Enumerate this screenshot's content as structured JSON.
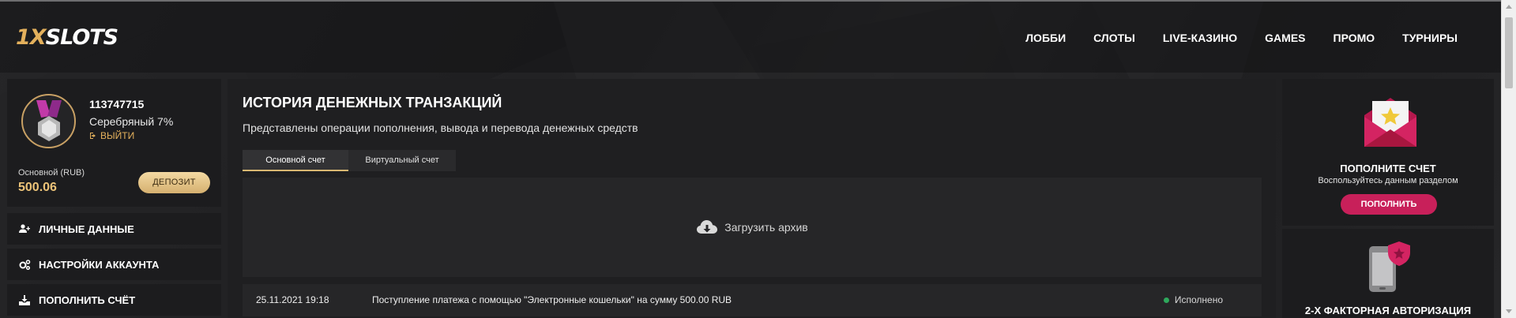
{
  "header": {
    "logo": {
      "one": "1",
      "x": "X",
      "slots": "SLOTS"
    },
    "nav": [
      "ЛОББИ",
      "СЛОТЫ",
      "LIVE-КАЗИНО",
      "GAMES",
      "ПРОМО",
      "ТУРНИРЫ"
    ]
  },
  "profile": {
    "user_id": "113747715",
    "level": "Серебряный 7%",
    "logout": "ВЫЙТИ",
    "balance_label": "Основной (RUB)",
    "balance_value": "500.06",
    "deposit_button": "ДЕПОЗИТ"
  },
  "sidebar": {
    "items": [
      {
        "label": "ЛИЧНЫЕ ДАННЫЕ",
        "icon": "user-plus-icon"
      },
      {
        "label": "НАСТРОЙКИ АККАУНТА",
        "icon": "gears-icon"
      },
      {
        "label": "ПОПОЛНИТЬ СЧЁТ",
        "icon": "download-icon"
      }
    ]
  },
  "main": {
    "title": "ИСТОРИЯ ДЕНЕЖНЫХ ТРАНЗАКЦИЙ",
    "subtitle": "Представлены операции пополнения, вывода и перевода денежных средств",
    "tabs": [
      {
        "label": "Основной счет",
        "active": true
      },
      {
        "label": "Виртуальный счет",
        "active": false
      }
    ],
    "archive_label": "Загрузить архив",
    "transactions": [
      {
        "date": "25.11.2021 19:18",
        "description": "Поступление платежа с помощью \"Электронные кошельки\" на сумму 500.00 RUB",
        "status": "Исполнено"
      }
    ]
  },
  "right": {
    "card1": {
      "title": "ПОПОЛНИТЕ СЧЕТ",
      "subtitle": "Воспользуйтесь данным разделом",
      "button": "ПОПОЛНИТЬ"
    },
    "card2": {
      "title": "2-Х ФАКТОРНАЯ АВТОРИЗАЦИЯ"
    }
  },
  "colors": {
    "accent_gold": "#e3b05c",
    "accent_pink": "#c8205a",
    "status_green": "#2ea85c"
  }
}
